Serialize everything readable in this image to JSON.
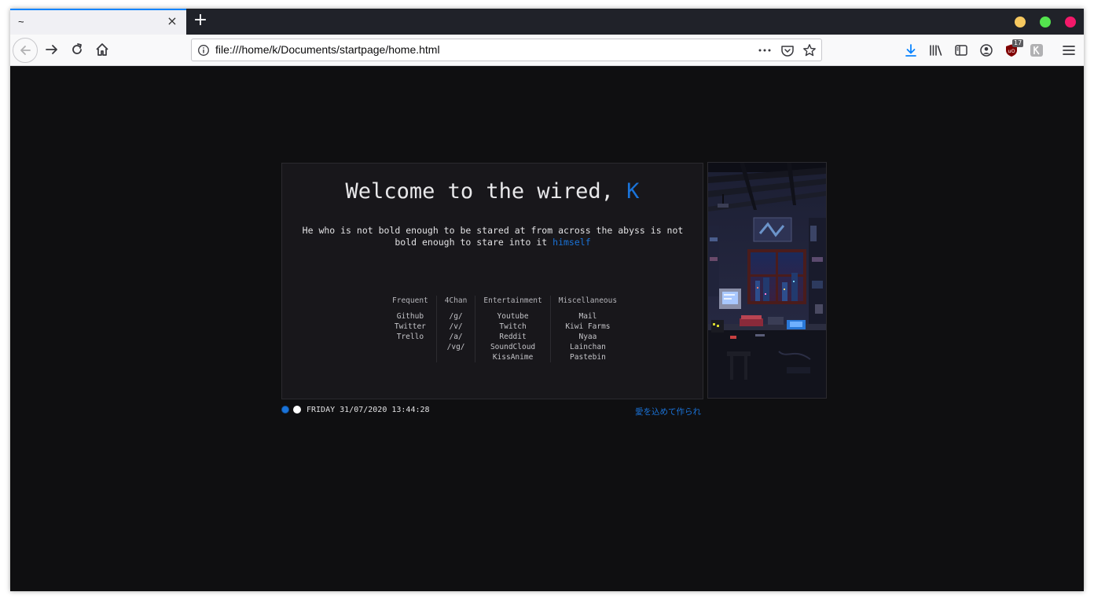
{
  "browser": {
    "tab_title": "~",
    "tab_close": "×",
    "new_tab": "+",
    "url": "file:///home/k/Documents/startpage/home.html",
    "ublock_count": "17",
    "colors": {
      "accent": "#0a84ff",
      "tabbar": "#202229",
      "toolbar": "#f9f9fa"
    }
  },
  "page": {
    "welcome_prefix": "Welcome to the wired, ",
    "welcome_name": "K",
    "quote_main": "He who is not bold enough to be stared at from across the abyss is not bold enough to stare into it ",
    "quote_accent": "himself",
    "columns": [
      {
        "title": "Frequent",
        "links": [
          "Github",
          "Twitter",
          "Trello"
        ]
      },
      {
        "title": "4Chan",
        "links": [
          "/g/",
          "/v/",
          "/a/",
          "/vg/"
        ]
      },
      {
        "title": "Entertainment",
        "links": [
          "Youtube",
          "Twitch",
          "Reddit",
          "SoundCloud",
          "KissAnime"
        ]
      },
      {
        "title": "Miscellaneous",
        "links": [
          "Mail",
          "Kiwi Farms",
          "Nyaa",
          "Lainchan",
          "Pastebin"
        ]
      }
    ],
    "datetime": "FRIDAY 31/07/2020 13:44:28",
    "made_with_love": "愛を込めて作られ",
    "colors": {
      "background": "#0f0f11",
      "card": "#18171b",
      "accent": "#1a73d9"
    }
  }
}
